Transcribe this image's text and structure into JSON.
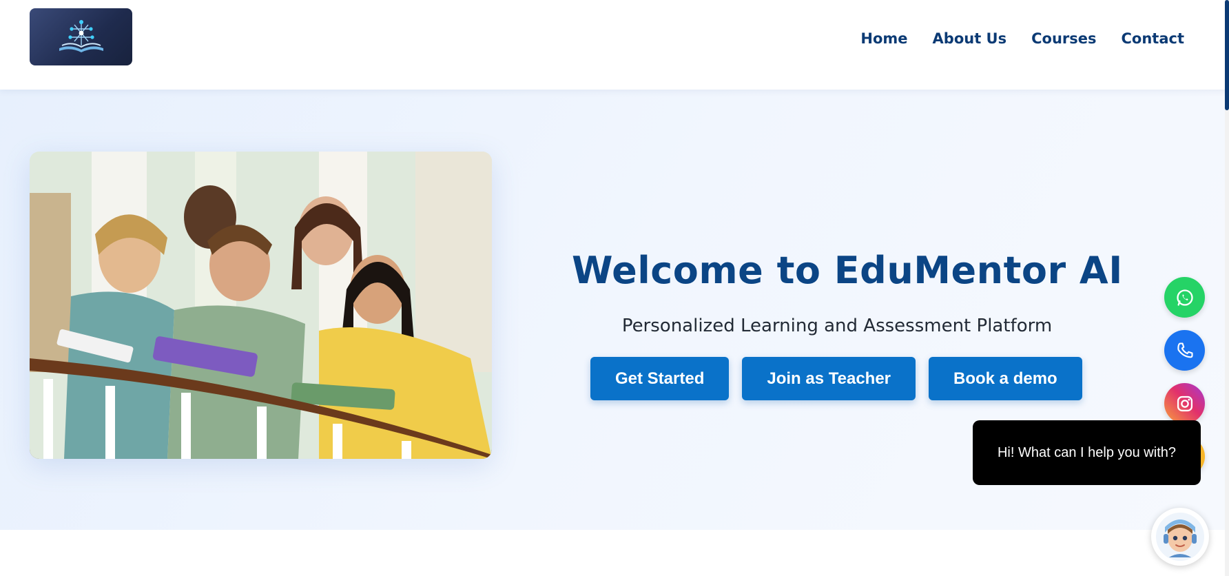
{
  "nav": {
    "items": [
      "Home",
      "About Us",
      "Courses",
      "Contact"
    ]
  },
  "hero": {
    "title": "Welcome to EduMentor AI",
    "subtitle": "Personalized Learning and Assessment Platform",
    "buttons": [
      "Get Started",
      "Join as Teacher",
      "Book a demo"
    ]
  },
  "chat": {
    "message": "Hi! What can I help you with?"
  },
  "icons": {
    "whatsapp": "whatsapp-icon",
    "phone": "phone-icon",
    "instagram": "instagram-icon"
  },
  "colors": {
    "nav_text": "#0b3a74",
    "title": "#0b4585",
    "button_bg": "#0a72c9",
    "whatsapp": "#25d366",
    "phone": "#1a73f0"
  }
}
